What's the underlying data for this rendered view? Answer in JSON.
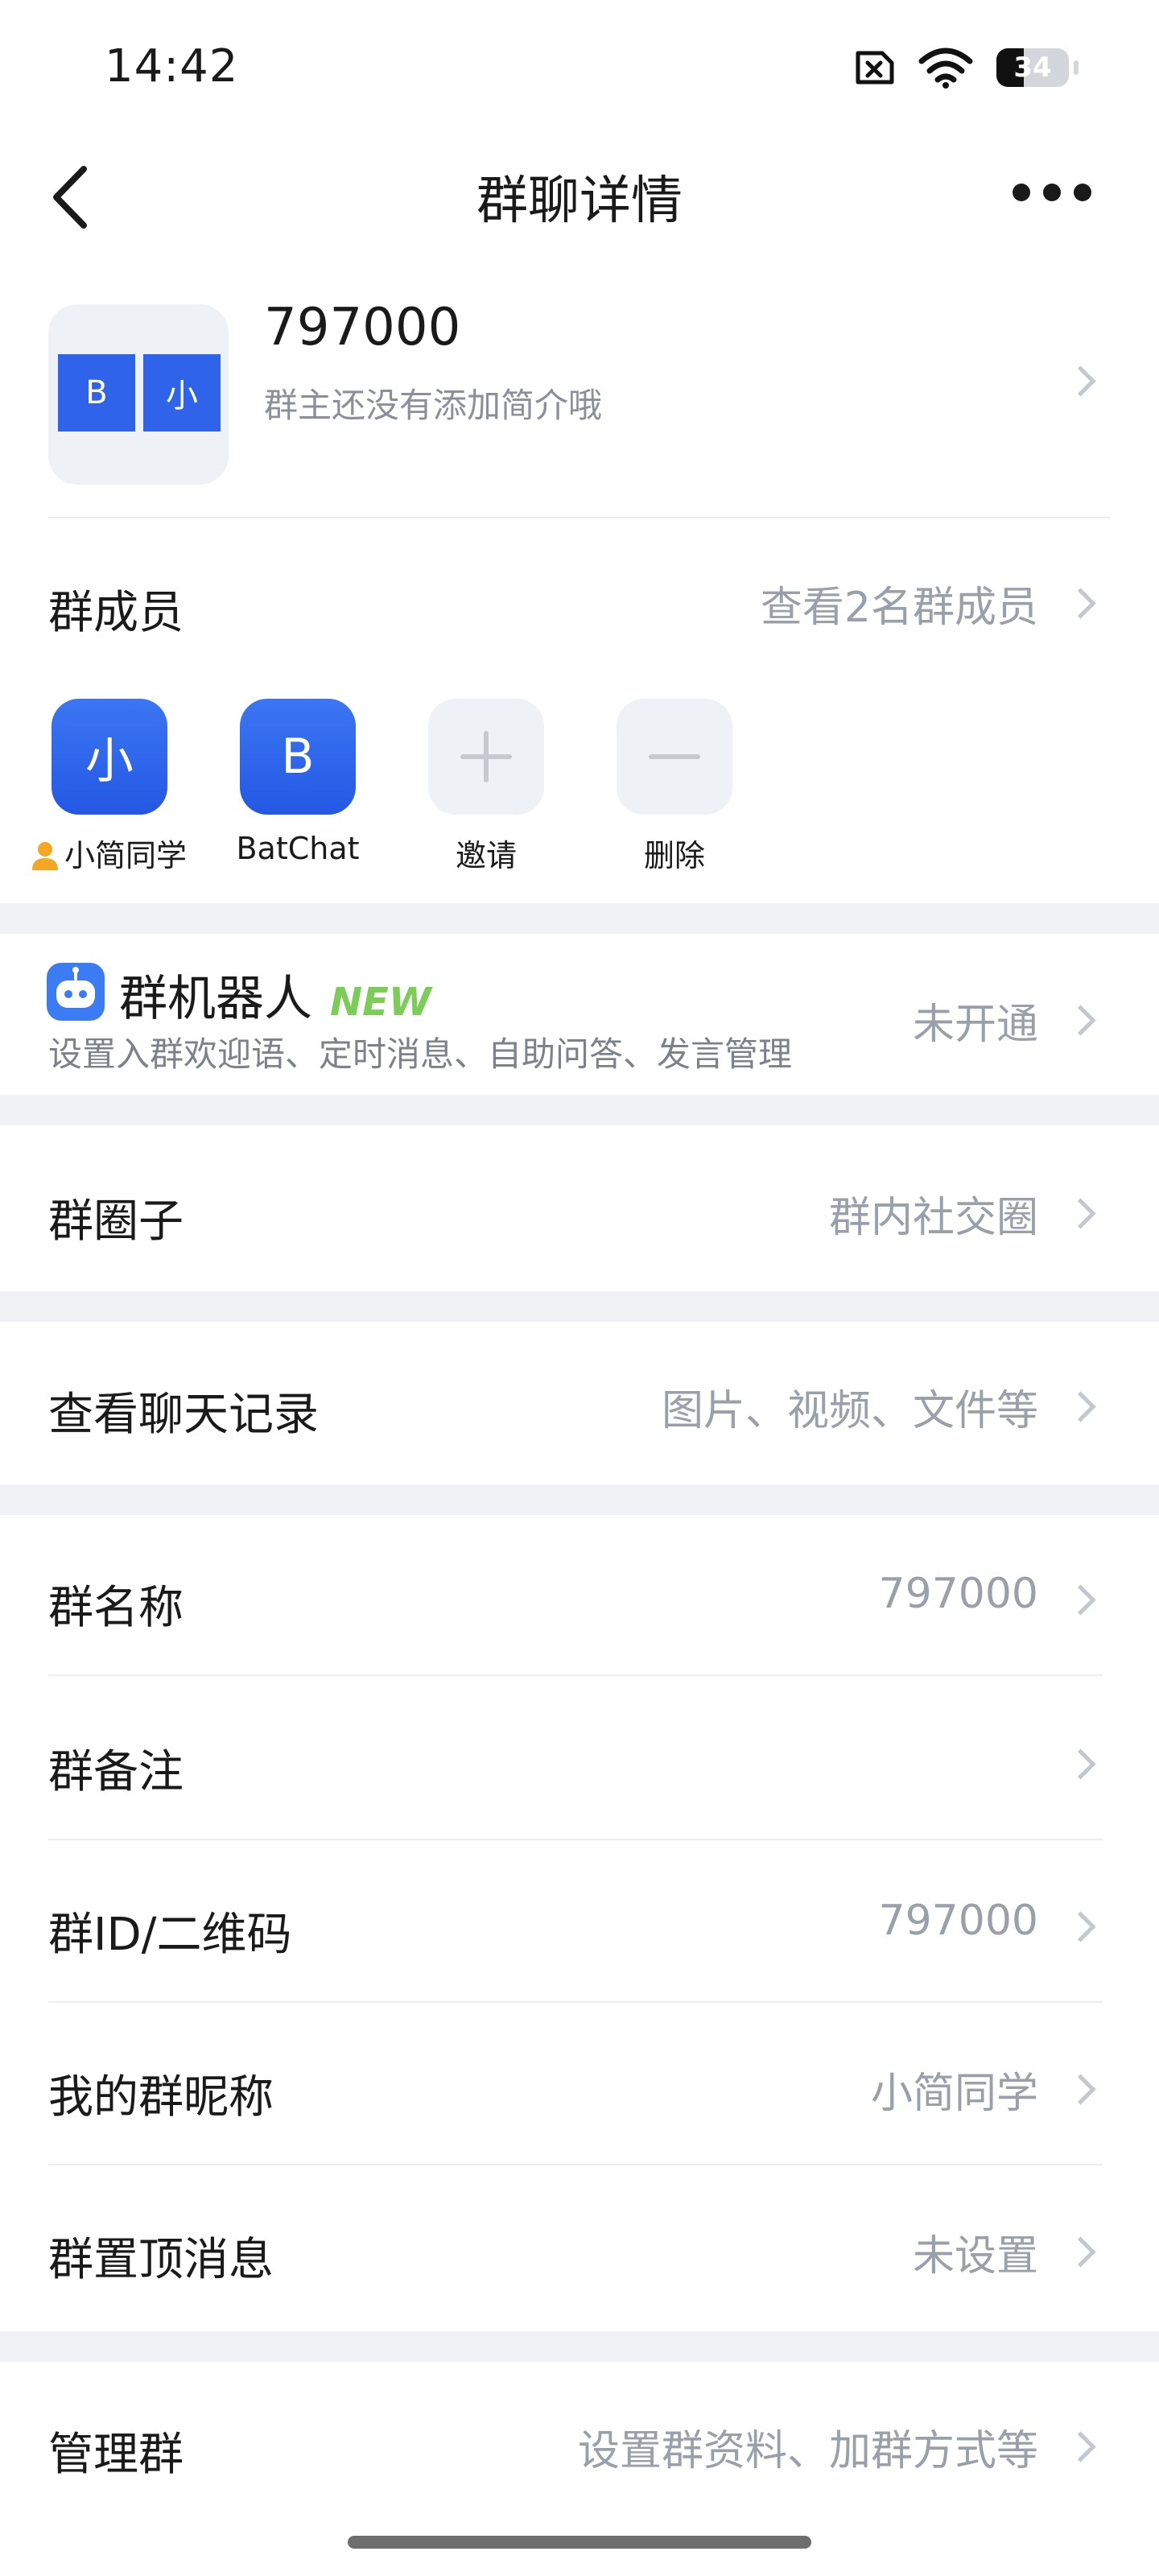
{
  "status": {
    "time": "14:42",
    "battery": "34"
  },
  "nav": {
    "title": "群聊详情"
  },
  "group": {
    "name": "797000",
    "intro": "群主还没有添加简介哦",
    "avatar_tiles": [
      "B",
      "小"
    ]
  },
  "members": {
    "label": "群成员",
    "value": "查看2名群成员",
    "items": [
      {
        "initial": "小",
        "name": "小简同学"
      },
      {
        "initial": "B",
        "name": "BatChat"
      },
      {
        "initial": "+",
        "name": "邀请"
      },
      {
        "initial": "—",
        "name": "删除"
      }
    ]
  },
  "robot": {
    "title": "群机器人",
    "badge": "NEW",
    "desc": "设置入群欢迎语、定时消息、自助问答、发言管理",
    "value": "未开通"
  },
  "circle": {
    "label": "群圈子",
    "value": "群内社交圈"
  },
  "history": {
    "label": "查看聊天记录",
    "value": "图片、视频、文件等"
  },
  "settings": [
    {
      "label": "群名称",
      "value": "797000"
    },
    {
      "label": "群备注",
      "value": ""
    },
    {
      "label": "群ID/二维码",
      "value": "797000"
    },
    {
      "label": "我的群昵称",
      "value": "小简同学"
    },
    {
      "label": "群置顶消息",
      "value": "未设置"
    }
  ],
  "manage": {
    "label": "管理群",
    "value": "设置群资料、加群方式等"
  }
}
